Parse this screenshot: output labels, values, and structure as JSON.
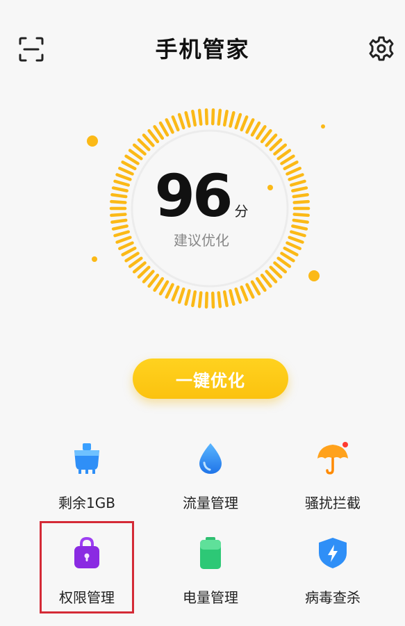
{
  "header": {
    "title": "手机管家",
    "scan_icon": "scan-icon",
    "settings_icon": "gear-icon"
  },
  "score": {
    "value": "96",
    "unit": "分",
    "hint": "建议优化",
    "accent": "#fbb917"
  },
  "actions": {
    "optimize_label": "一键优化"
  },
  "tools": [
    {
      "label": "剩余1GB",
      "icon": "clean-icon"
    },
    {
      "label": "流量管理",
      "icon": "water-drop-icon"
    },
    {
      "label": "骚扰拦截",
      "icon": "umbrella-icon"
    },
    {
      "label": "权限管理",
      "icon": "lock-bag-icon"
    },
    {
      "label": "电量管理",
      "icon": "battery-icon"
    },
    {
      "label": "病毒查杀",
      "icon": "shield-icon"
    }
  ]
}
